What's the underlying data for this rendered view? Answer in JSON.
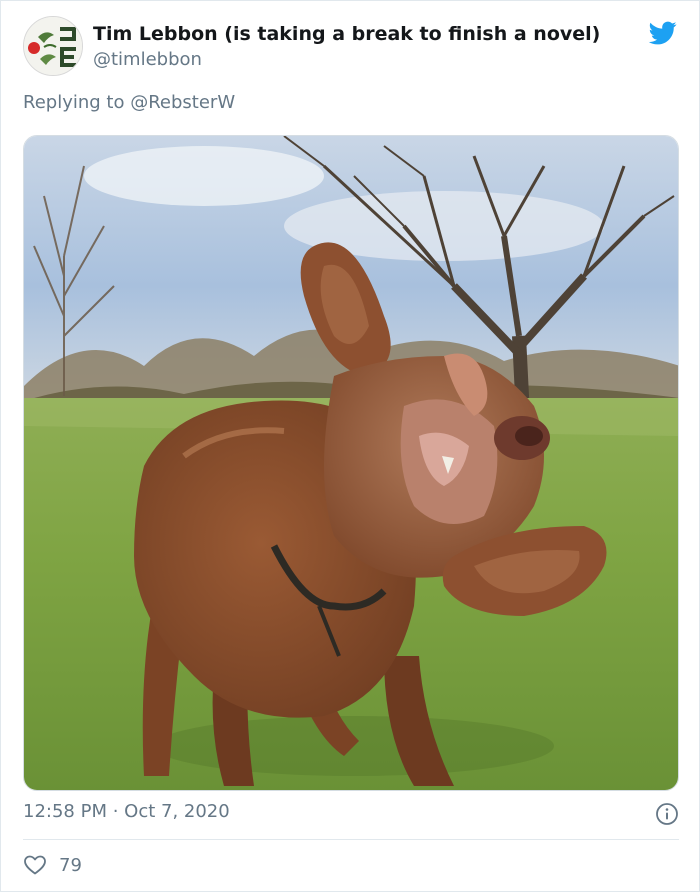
{
  "tweet": {
    "author_name": "Tim Lebbon (is taking a break to finish a novel)",
    "author_handle": "@timlebbon",
    "reply_prefix": "Replying to",
    "reply_mention": "@RebsterW",
    "timestamp": "12:58 PM · Oct 7, 2020",
    "like_count": "79"
  },
  "icons": {
    "logo": "twitter-bird-icon",
    "info": "info-icon",
    "like": "heart-icon"
  },
  "colors": {
    "twitter_blue": "#1da1f2",
    "secondary_text": "#657786",
    "primary_text": "#14171a",
    "divider": "#e1e8ed"
  },
  "media": {
    "description_subject": "brown dog shaking head in grassy park"
  }
}
